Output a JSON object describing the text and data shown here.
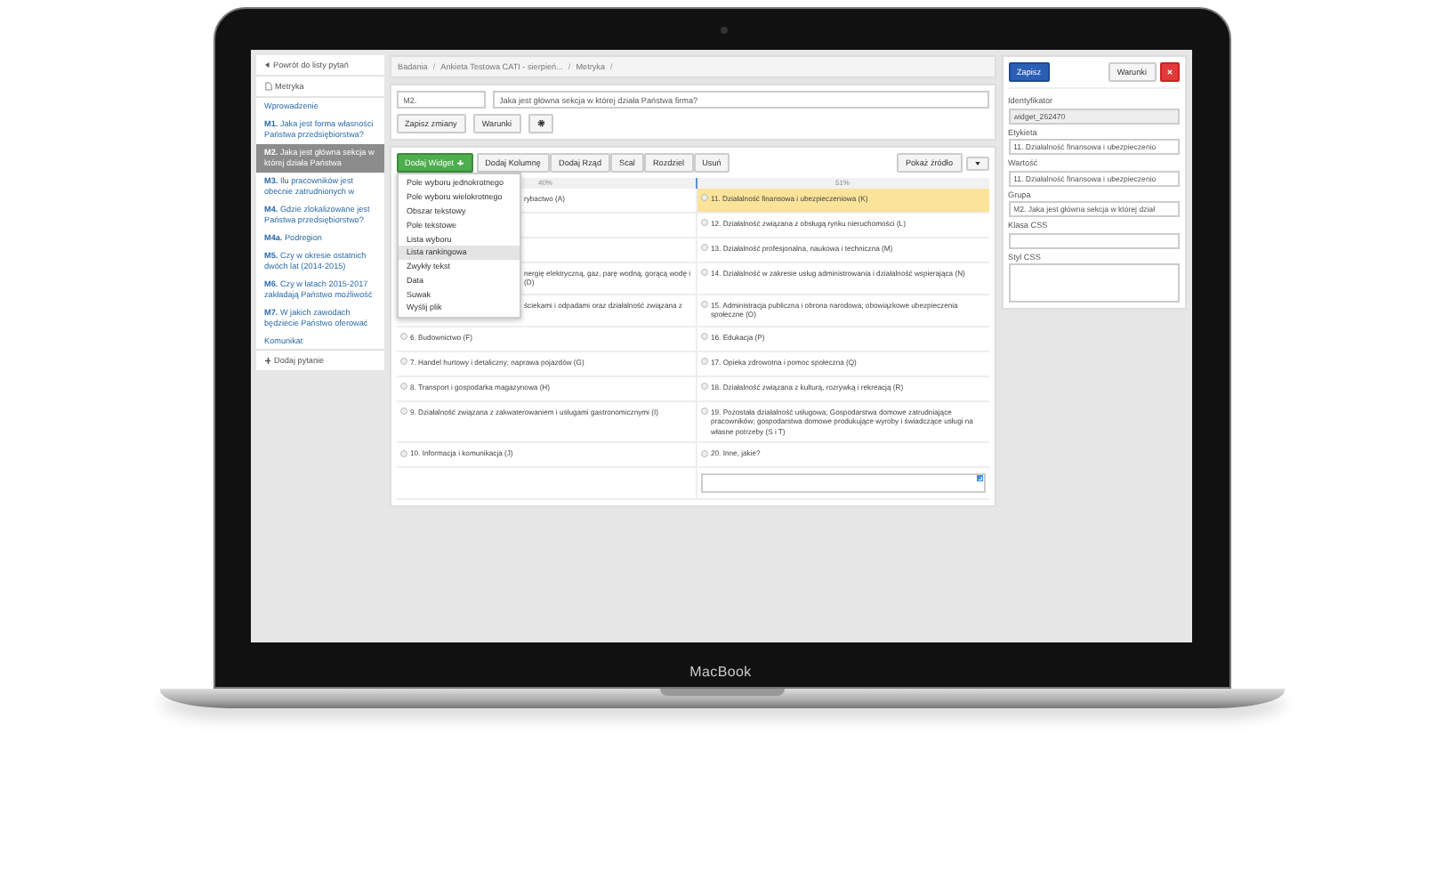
{
  "device": {
    "brand": "MacBook"
  },
  "sidebar": {
    "back": "Powrót do listy pytań",
    "section": "Metryka",
    "items": [
      {
        "text": "Wprowadzenie",
        "selected": false
      },
      {
        "text": "**M1.** Jaka jest forma własności Państwa przedsiębiorstwa?",
        "selected": false
      },
      {
        "text": "**M2.** Jaka jest główna sekcja w której działa Państwa",
        "selected": true
      },
      {
        "text": "**M3.** Ilu pracowników jest obecnie zatrudnionych w",
        "selected": false
      },
      {
        "text": "**M4.** Gdzie zlokalizowane jest Państwa przedsiębiorstwo?",
        "selected": false
      },
      {
        "text": "**M4a.** Podregion",
        "selected": false
      },
      {
        "text": "**M5.** Czy w okresie ostatnich dwóch lat (2014-2015)",
        "selected": false
      },
      {
        "text": "**M6.** Czy w latach 2015-2017 zakładają Państwo możliwość",
        "selected": false
      },
      {
        "text": "**M7.** W jakich zawodach będziecie Państwo oferować",
        "selected": false
      },
      {
        "text": "Komunikat",
        "selected": false
      }
    ],
    "add": "Dodaj pytanie"
  },
  "breadcrumb": {
    "separator": "/",
    "items": [
      "Badania",
      "Ankieta Testowa CATI - sierpień...",
      "Metryka"
    ]
  },
  "question": {
    "code": "M2.",
    "title": "Jaka jest główna sekcja w której działa Państwa firma?",
    "buttons": [
      "Zapisz zmiany",
      "Warunki"
    ]
  },
  "toolbar": {
    "add_widget": "Dodaj Widget",
    "buttons": [
      "Dodaj Kolumnę",
      "Dodaj Rząd",
      "Scal",
      "Rozdziel",
      "Usuń"
    ],
    "source": "Pokaż źródło"
  },
  "widget_menu": [
    {
      "label": "Pole wyboru jednokrotnego",
      "selected": false
    },
    {
      "label": "Pole wyboru wielokrotnego",
      "selected": false
    },
    {
      "label": "Obszar tekstowy",
      "selected": false
    },
    {
      "label": "Pole tekstowe",
      "selected": false
    },
    {
      "label": "Lista wyboru",
      "selected": false
    },
    {
      "label": "Lista rankingowa",
      "selected": true
    },
    {
      "label": "Zwykły tekst",
      "selected": false
    },
    {
      "label": "Data",
      "selected": false
    },
    {
      "label": "Suwak",
      "selected": false
    },
    {
      "label": "Wyślij plik",
      "selected": false
    }
  ],
  "grid": {
    "columns": [
      "40%",
      "51%"
    ],
    "rows": [
      [
        {
          "kind": "covered",
          "lines": [
            "rybactwo (A)"
          ]
        },
        {
          "kind": "option",
          "text": "11. Działalność finansowa i ubezpieczeniowa (K)",
          "selected": true
        }
      ],
      [
        {
          "kind": "covered"
        },
        {
          "kind": "option",
          "text": "12. Działalność związana z obsługą rynku nieruchomości (L)",
          "selected": false
        }
      ],
      [
        {
          "kind": "covered"
        },
        {
          "kind": "option",
          "text": "13. Działalność profesjonalna, naukowa i techniczna (M)",
          "selected": false
        }
      ],
      [
        {
          "kind": "covered",
          "lines": [
            "nergię elektryczną, gaz, parę wodną, gorącą wodę i",
            "(D)"
          ]
        },
        {
          "kind": "option",
          "text": "14. Działalność w zakresie usług administrowania i działalność wspierająca (N)",
          "selected": false
        }
      ],
      [
        {
          "kind": "covered",
          "lines": [
            "ściekami i odpadami oraz działalność związana z"
          ]
        },
        {
          "kind": "option",
          "text": "15. Administracja publiczna i obrona narodowa; obowiązkowe ubezpieczenia społeczne (O)",
          "selected": false
        }
      ],
      [
        {
          "kind": "option",
          "text": "6. Budownictwo (F)",
          "selected": false
        },
        {
          "kind": "option",
          "text": "16. Edukacja (P)",
          "selected": false
        }
      ],
      [
        {
          "kind": "option",
          "text": "7. Handel hurtowy i detaliczny; naprawa pojazdów (G)",
          "selected": false
        },
        {
          "kind": "option",
          "text": "17. Opieka zdrowotna i pomoc społeczna (Q)",
          "selected": false
        }
      ],
      [
        {
          "kind": "option",
          "text": "8. Transport i gospodarka magazynowa (H)",
          "selected": false
        },
        {
          "kind": "option",
          "text": "18. Działalność związana z kulturą, rozrywką i rekreacją (R)",
          "selected": false
        }
      ],
      [
        {
          "kind": "option",
          "text": "9. Działalność związana z zakwaterowaniem i usługami gastronomicznymi (I)",
          "selected": false
        },
        {
          "kind": "option",
          "text": "19. Pozostała działalność usługowa; Gospodarstwa domowe zatrudniające pracowników; gospodarstwa domowe produkujące wyroby i świadczące usługi na własne potrzeby (S i T)",
          "selected": false
        }
      ],
      [
        {
          "kind": "option",
          "text": "10. Informacja i komunikacja (J)",
          "selected": false
        },
        {
          "kind": "option",
          "text": "20. Inne, jakie?",
          "selected": false
        }
      ],
      [
        {
          "kind": "empty"
        },
        {
          "kind": "input"
        }
      ]
    ]
  },
  "properties": {
    "save": "Zapisz",
    "conditions": "Warunki",
    "fields": [
      {
        "label": "Identyfikator",
        "value": "widget_262470",
        "kind": "readonly"
      },
      {
        "label": "Etykieta",
        "value": "11. Działalność finansowa i ubezpieczenio",
        "kind": "text"
      },
      {
        "label": "Wartość",
        "value": "11. Działalność finansowa i ubezpieczenio",
        "kind": "text"
      },
      {
        "label": "Grupa",
        "value": "M2. Jaka jest główna sekcja w której dział",
        "kind": "text"
      },
      {
        "label": "Klasa CSS",
        "kind": "text"
      },
      {
        "label": "Styl CSS",
        "kind": "textarea"
      }
    ]
  }
}
